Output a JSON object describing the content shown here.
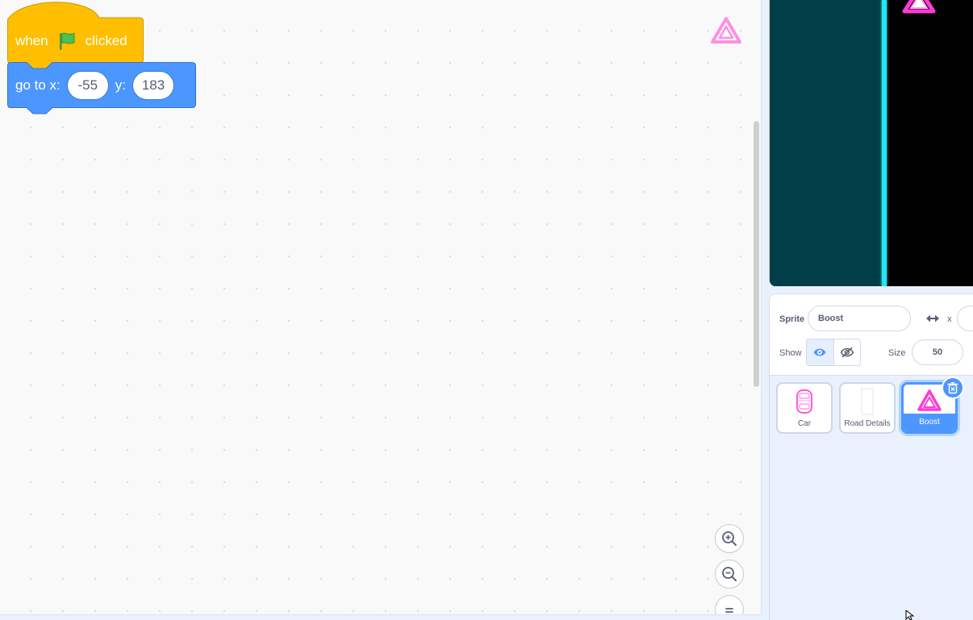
{
  "workspace": {
    "hat_block": {
      "text_when": "when",
      "text_clicked": "clicked",
      "icon": "green-flag-icon"
    },
    "motion_block": {
      "label_go_to_x": "go to x:",
      "x_value": "-55",
      "label_y": "y:",
      "y_value": "183"
    },
    "zoom_controls": [
      "zoom-in-icon",
      "zoom-out-icon",
      "zoom-reset-icon"
    ]
  },
  "sprite_info": {
    "sprite_label": "Sprite",
    "sprite_name": "Boost",
    "x_label": "x",
    "show_label": "Show",
    "size_label": "Size",
    "size_value": "50"
  },
  "sprites": [
    {
      "name": "Car",
      "selected": false
    },
    {
      "name": "Road Details",
      "selected": false
    },
    {
      "name": "Boost",
      "selected": true
    }
  ],
  "colors": {
    "events_block": "#ffbf00",
    "motion_block": "#4c97ff",
    "stage_teal": "#003f47",
    "stage_line": "#22e6f6",
    "sprite_neon": "#ff3bd5"
  }
}
